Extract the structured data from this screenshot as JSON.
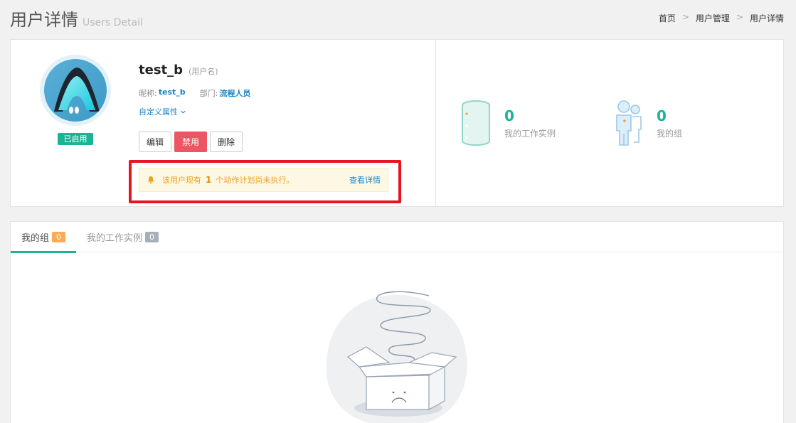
{
  "header": {
    "title": "用户详情",
    "subtitle": "Users Detail",
    "breadcrumb": [
      "首页",
      "用户管理",
      "用户详情"
    ],
    "breadcrumb_sep": ">"
  },
  "profile": {
    "status": "已启用",
    "username": "test_b",
    "username_hint": "(用户名)",
    "nickname_label": "昵称:",
    "nickname": "test_b",
    "dept_label": "部门:",
    "dept": "流程人员",
    "custom_attr": "自定义属性",
    "buttons": {
      "edit": "编辑",
      "disable": "禁用",
      "delete": "删除"
    },
    "alert": {
      "prefix": "该用户现有",
      "count": "1",
      "suffix": "个动作计划尚未执行。",
      "link": "查看详情"
    }
  },
  "stats": [
    {
      "value": "0",
      "label": "我的工作实例",
      "icon": "database-icon"
    },
    {
      "value": "0",
      "label": "我的组",
      "icon": "group-icon"
    }
  ],
  "tabs": [
    {
      "label": "我的组",
      "count": "0",
      "active": true
    },
    {
      "label": "我的工作实例",
      "count": "0",
      "active": false
    }
  ],
  "colors": {
    "accent": "#1ab394",
    "danger": "#ed5565",
    "link": "#1c84c6",
    "warning": "#f8ac59",
    "highlight": "#e8141e"
  }
}
